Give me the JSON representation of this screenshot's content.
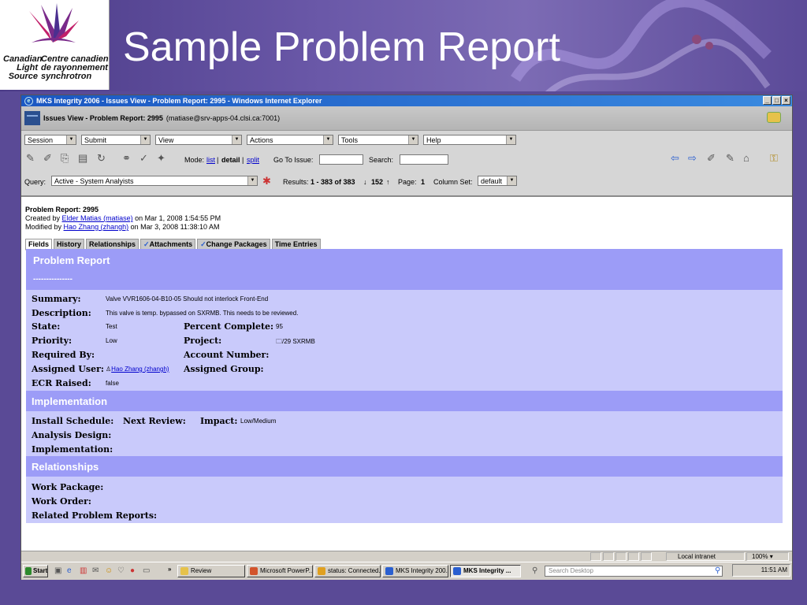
{
  "slide": {
    "title": "Sample Problem Report",
    "logo_en": "Canadian Light Source",
    "logo_fr": "Centre canadien de rayonnement synchrotron"
  },
  "window": {
    "title": "MKS Integrity 2006 - Issues View - Problem Report: 2995 - Windows Internet Explorer",
    "controls": [
      "_",
      "□",
      "×"
    ]
  },
  "header": {
    "view": "Issues View - Problem Report: 2995",
    "server": "(matiase@srv-apps-04.clsi.ca:7001)"
  },
  "menus": [
    {
      "label": "Session"
    },
    {
      "label": "Submit"
    },
    {
      "label": "View"
    },
    {
      "label": "Actions"
    },
    {
      "label": "Tools"
    },
    {
      "label": "Help"
    }
  ],
  "toolbar": {
    "mode_label": "Mode:",
    "mode_list": "list",
    "mode_sep1": "|",
    "mode_detail": "detail",
    "mode_sep2": "|",
    "mode_split": "split",
    "goto_label": "Go To Issue:",
    "search_label": "Search:",
    "query_label": "Query:",
    "query_value": "Active - System Analyists",
    "results_label": "Results:",
    "results_value": "1 - 383 of 383",
    "results_down": "↓",
    "results_count": "152",
    "results_up": "↑",
    "page_label": "Page:",
    "page_value": "1",
    "columnset_label": "Column Set:",
    "columnset_value": "default"
  },
  "record": {
    "heading": "Problem Report: 2995",
    "created_prefix": "Created by",
    "created_by": "Elder Matias (matiase)",
    "created_on": "on Mar 1, 2008 1:54:55 PM",
    "modified_prefix": "Modified by",
    "modified_by": "Hao Zhang (zhangh)",
    "modified_on": "on Mar 3, 2008 11:38:10 AM"
  },
  "tabs": [
    {
      "label": "Fields"
    },
    {
      "label": "History"
    },
    {
      "label": "Relationships"
    },
    {
      "label": "Attachments"
    },
    {
      "label": "Change Packages"
    },
    {
      "label": "Time Entries"
    }
  ],
  "form": {
    "section1_title": "Problem Report",
    "section1_divider": "---------------",
    "summary_label": "Summary:",
    "summary_value": "Valve VVR1606-04-B10-05 Should not interlock Front-End",
    "description_label": "Description:",
    "description_value": "This valve is temp. bypassed on SXRMB.  This needs to be reviewed.",
    "state_label": "State:",
    "state_value": "Test",
    "percent_label": "Percent Complete:",
    "percent_value": "95",
    "priority_label": "Priority:",
    "priority_value": "Low",
    "project_label": "Project:",
    "project_value": "/29 SXRMB",
    "required_label": "Required By:",
    "account_label": "Account Number:",
    "assigned_user_label": "Assigned User:",
    "assigned_user_value": "Hao Zhang (zhangh)",
    "assigned_group_label": "Assigned Group:",
    "ecr_label": "ECR Raised:",
    "ecr_value": "false",
    "section2_title": "Implementation",
    "install_label": "Install Schedule:",
    "next_review_label": "Next Review:",
    "impact_label": "Impact:",
    "impact_value": "Low/Medium",
    "analysis_label": "Analysis Design:",
    "implementation_label": "Implementation:",
    "section3_title": "Relationships",
    "work_package_label": "Work Package:",
    "work_order_label": "Work Order:",
    "related_label": "Related Problem Reports:"
  },
  "statusbar": {
    "zone": "Local intranet",
    "zoom": "100%"
  },
  "taskbar": {
    "start": "Start",
    "chevron": "»",
    "items": [
      {
        "label": "Review"
      },
      {
        "label": "Microsoft PowerP..."
      },
      {
        "label": "status: Connected..."
      },
      {
        "label": "MKS Integrity 200..."
      },
      {
        "label": "MKS Integrity ..."
      }
    ],
    "search_placeholder": "Search Desktop",
    "clock": "11:51 AM"
  },
  "colors": {
    "section_header": "#9c9cf7",
    "panel": "#c9cafb",
    "link": "#0000cc",
    "slide_bg": "#5a4a96"
  }
}
